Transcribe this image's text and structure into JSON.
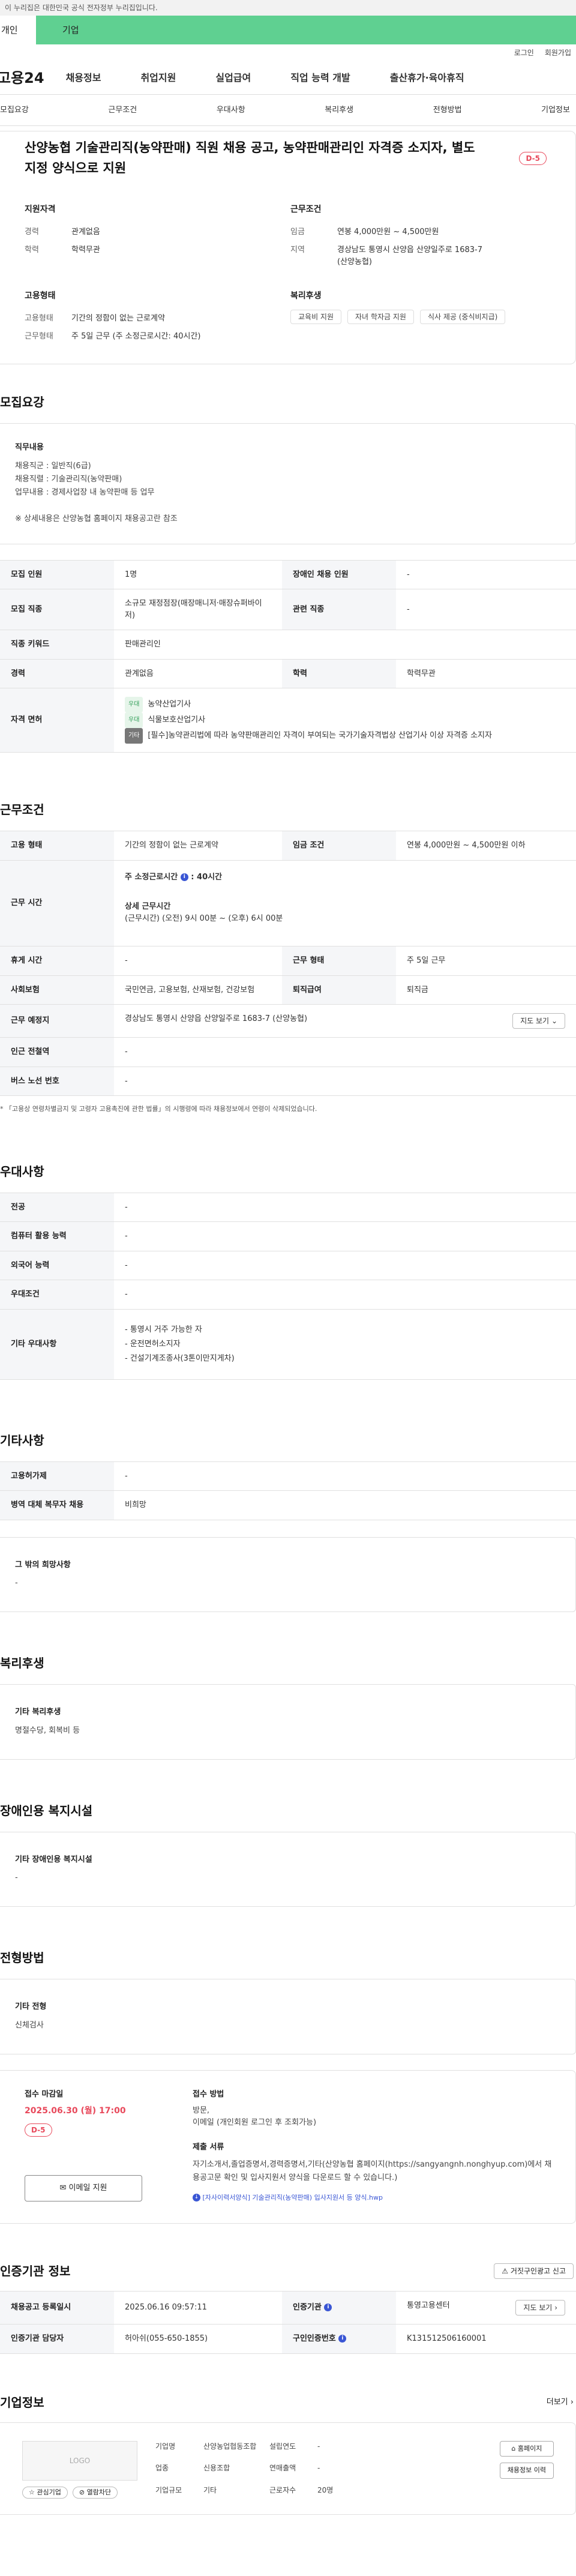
{
  "gov_notice": "이 누리집은 대한민국 공식 전자정부 누리집입니다.",
  "segments": {
    "personal": "개인",
    "company": "기업"
  },
  "util": {
    "login": "로그인",
    "join": "회원가입"
  },
  "logo": "고용24",
  "gnb": [
    "채용정보",
    "취업지원",
    "실업급여",
    "직업 능력 개발",
    "출산휴가·육아휴직"
  ],
  "tabs": [
    "모집요강",
    "근무조건",
    "우대사항",
    "복리후생",
    "전형방법",
    "기업정보"
  ],
  "summary": {
    "title": "산양농협 기술관리직(농약판매) 직원 채용 공고, 농약판매관리인 자격증 소지자, 별도 지정 양식으로 지원",
    "dday": "D-5",
    "qual_title": "지원자격",
    "career_k": "경력",
    "career_v": "관계없음",
    "edu_k": "학력",
    "edu_v": "학력무관",
    "cond_title": "근무조건",
    "wage_k": "임금",
    "wage_v": "연봉 4,000만원 ~ 4,500만원",
    "region_k": "지역",
    "region_v": "경상남도 통영시 산양읍 산양일주로 1683-7 (산양농협)",
    "emp_title": "고용형태",
    "emptype_k": "고용형태",
    "emptype_v": "기간의 정함이 없는 근로계약",
    "workform_k": "근무형태",
    "workform_v": "주 5일 근무 (주 소정근로시간: 40시간)",
    "welfare_title": "복리후생",
    "welfare_tags": [
      "교육비 지원",
      "자녀 학자금 지원",
      "식사 제공 (중식비지급)"
    ]
  },
  "recruit": {
    "heading": "모집요강",
    "duty_title": "직무내용",
    "duty_lines": [
      "채용직군 : 일반직(6급)",
      "채용직렬 : 기술관리직(농약판매)",
      "업무내용 : 경제사업장 내 농약판매 등 업무",
      "",
      "※ 상세내용은 산양농협 홈페이지 채용공고란 참조"
    ],
    "rows": [
      {
        "k1": "모집 인원",
        "v1": "1명",
        "k2": "장애인 채용 인원",
        "v2": "-"
      },
      {
        "k1": "모집 직종",
        "v1": "소규모 재정점장(매장매니저·매장슈퍼바이저)",
        "k2": "관련 직종",
        "v2": "-"
      },
      {
        "k1": "직종 키워드",
        "v1": "판매관리인"
      },
      {
        "k1": "경력",
        "v1": "관계없음",
        "k2": "학력",
        "v2": "학력무관"
      }
    ],
    "license_k": "자격 면허",
    "licenses": [
      {
        "badge": "우대",
        "text": "농약산업기사"
      },
      {
        "badge": "우대",
        "text": "식물보호산업기사"
      },
      {
        "badge": "기타",
        "text": "[필수]농약관리법에 따라 농약판매관리인 자격이 부여되는 국가기술자격법상 산업기사 이상 자격증 소지자"
      }
    ]
  },
  "work": {
    "heading": "근무조건",
    "r1": {
      "k1": "고용 형태",
      "v1": "기간의 정함이 없는 근로계약",
      "k2": "임금 조건",
      "v2": "연봉 4,000만원 ~ 4,500만원 이하"
    },
    "hours_k": "근무 시간",
    "hours_week": "주 소정근로시간",
    "hours_week_v": "40시간",
    "hours_detail_t": "상세 근무시간",
    "hours_detail_v": "(근무시간) (오전) 9시 00분 ~ (오후) 6시 00분",
    "r3": {
      "k1": "휴게 시간",
      "v1": "-",
      "k2": "근무 형태",
      "v2": "주 5일 근무"
    },
    "r4": {
      "k1": "사회보험",
      "v1": "국민연금, 고용보험, 산재보험, 건강보험",
      "k2": "퇴직급여",
      "v2": "퇴직금"
    },
    "r5": {
      "k1": "근무 예정지",
      "v1": "경상남도 통영시 산양읍 산양일주로 1683-7 (산양농협)",
      "btn": "지도 보기"
    },
    "r6": {
      "k1": "인근 전철역",
      "v1": "-"
    },
    "r7": {
      "k1": "버스 노선 번호",
      "v1": "-"
    },
    "note": "* 「고용상 연령차별금지 및 고령자 고용촉진에 관한 법률」의 시행령에 따라 채용정보에서 연령이 삭제되었습니다."
  },
  "pref": {
    "heading": "우대사항",
    "rows": [
      {
        "k": "전공",
        "v": "-"
      },
      {
        "k": "컴퓨터 활용 능력",
        "v": "-"
      },
      {
        "k": "외국어 능력",
        "v": "-"
      },
      {
        "k": "우대조건",
        "v": "-"
      }
    ],
    "etc_k": "기타 우대사항",
    "etc_lines": [
      "- 통영시 거주 가능한 자",
      "- 운전면허소지자",
      "- 건설기계조종사(3톤이만지게차)"
    ]
  },
  "other": {
    "heading": "기타사항",
    "rows": [
      {
        "k": "고용허가제",
        "v": "-"
      },
      {
        "k": "병역 대체 복무자 채용",
        "v": "비희망"
      }
    ],
    "box_title": "그 밖의 희망사항",
    "box_v": "-"
  },
  "welfare": {
    "heading": "복리후생",
    "box_title": "기타 복리후생",
    "box_v": "명절수당, 회복비 등"
  },
  "disabled": {
    "heading": "장애인용 복지시설",
    "box_title": "기타 장애인용 복지시설",
    "box_v": "-"
  },
  "screen": {
    "heading": "전형방법",
    "box_title": "기타 전형",
    "box_v": "신체검사",
    "deadline_title": "접수 마감일",
    "deadline": "2025.06.30 (월) 17:00",
    "dday": "D-5",
    "method_title": "접수 방법",
    "method_lines": [
      "방문,",
      "이메일 (개인회원 로그인 후 조회가능)"
    ],
    "docs_title": "제출 서류",
    "docs_v": "자기소개서,졸업증명서,경력증명서,기타(산양농협 홈페이지(https://sangyangnh.nonghyup.com)에서 채용공고문 확인 및 입사지원서 양식을 다운로드 할 수 있습니다.)",
    "docs_link": "[자사이력서양식] 기술관리직(농약판매) 입사지원서 등 양식.hwp",
    "apply_btn": "이메일 지원"
  },
  "cert": {
    "heading": "인증기관 정보",
    "report_btn": "거짓구인광고 신고",
    "r1": {
      "k1": "채용공고 등록일시",
      "v1": "2025.06.16 09:57:11",
      "k2": "인증기관",
      "v2": "통영고용센터",
      "btn": "지도 보기"
    },
    "r2": {
      "k1": "인증기관 담당자",
      "v1": "허아쉬(055-650-1855)",
      "k2": "구인인증번호",
      "v2": "K131512506160001"
    }
  },
  "company": {
    "heading": "기업정보",
    "more": "더보기",
    "logo": "LOGO",
    "fav": "관심기업",
    "block": "열람차단",
    "name_k": "기업명",
    "name_v": "산양농업협동조합",
    "year_k": "설립연도",
    "year_v": "-",
    "ind_k": "업종",
    "ind_v": "신용조합",
    "sales_k": "연매출액",
    "sales_v": "-",
    "size_k": "기업규모",
    "size_v": "기타",
    "emp_k": "근로자수",
    "emp_v": "20명",
    "home_btn": "홈페이지",
    "history_btn": "채용정보 이력"
  }
}
